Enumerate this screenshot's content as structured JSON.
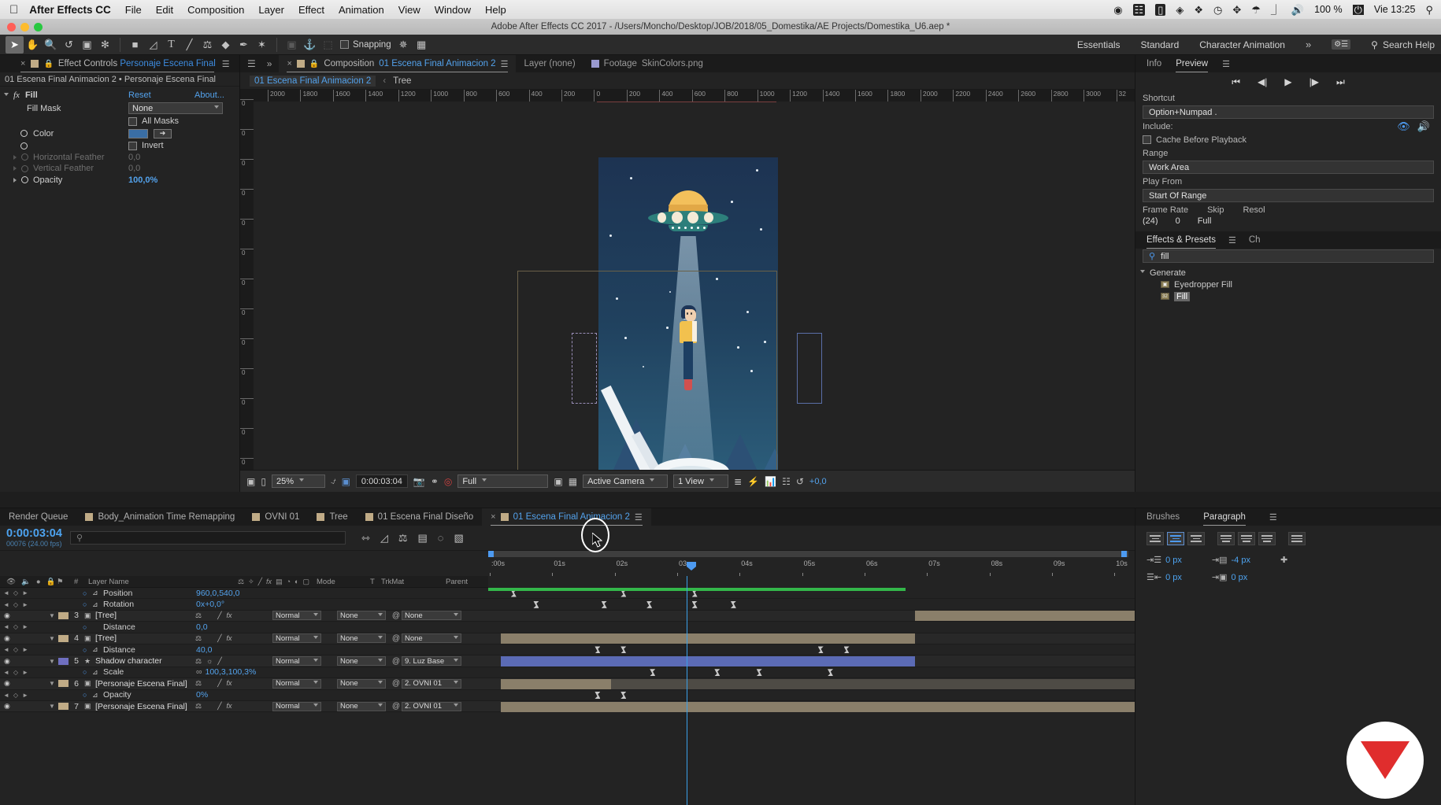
{
  "macbar": {
    "apple_icon": "apple-icon",
    "app_name": "After Effects CC",
    "menus": [
      "File",
      "Edit",
      "Composition",
      "Layer",
      "Effect",
      "Animation",
      "View",
      "Window",
      "Help"
    ],
    "status_icons": [
      "record-icon",
      "screen-share-icon",
      "display-icon",
      "dropbox-icon",
      "evernote-icon",
      "clock-icon",
      "bluetooth-icon",
      "wifi-icon",
      "airplay-icon",
      "volume-icon"
    ],
    "battery_percent": "100 %",
    "battery_icon": "battery-icon",
    "time": "Vie 13:25",
    "spotlight_icon": "search-icon"
  },
  "titlebar": {
    "title": "Adobe After Effects CC 2017 - /Users/Moncho/Desktop/JOB/2018/05_Domestika/AE Projects/Domestika_U6.aep *",
    "close_color": "#ff5f57",
    "min_color": "#febc2e",
    "max_color": "#28c840"
  },
  "toolbar": {
    "tools": [
      {
        "name": "selection-tool-icon",
        "glyph": "➤",
        "active": true
      },
      {
        "name": "hand-tool-icon",
        "glyph": "✋",
        "active": false
      },
      {
        "name": "zoom-tool-icon",
        "glyph": "🔍",
        "active": false
      },
      {
        "name": "rotation-tool-icon",
        "glyph": "↺",
        "active": false
      },
      {
        "name": "camera-tool-icon",
        "glyph": "🎥",
        "active": false
      },
      {
        "name": "pan-behind-tool-icon",
        "glyph": "✥",
        "active": false
      },
      {
        "name": "rectangle-tool-icon",
        "glyph": "■",
        "active": false
      },
      {
        "name": "pen-tool-icon",
        "glyph": "◹",
        "active": false
      },
      {
        "name": "type-tool-icon",
        "glyph": "T",
        "active": false
      },
      {
        "name": "brush-tool-icon",
        "glyph": "╱",
        "active": false
      },
      {
        "name": "clone-stamp-tool-icon",
        "glyph": "⚒",
        "active": false
      },
      {
        "name": "eraser-tool-icon",
        "glyph": "◆",
        "active": false
      },
      {
        "name": "roto-brush-tool-icon",
        "glyph": "✒",
        "active": false
      },
      {
        "name": "puppet-pin-tool-icon",
        "glyph": "✦",
        "active": false
      }
    ],
    "dim_tools": [
      {
        "name": "align-tool-icon",
        "glyph": "▣"
      },
      {
        "name": "anchor-tool-icon",
        "glyph": "⚓"
      },
      {
        "name": "mask-tool-icon",
        "glyph": "⬚"
      }
    ],
    "snapping_label": "Snapping",
    "snapping_checked": false,
    "snap_extra_icons": [
      "magnet-icon",
      "grid-icon"
    ],
    "workspaces": [
      "Essentials",
      "Standard",
      "Character Animation"
    ],
    "workspace_overflow": "»",
    "workspace_settings_icon": "workspace-settings-icon",
    "search_placeholder": "Search Help",
    "search_icon": "search-icon"
  },
  "effect_controls": {
    "tab_prefix": "Effect Controls",
    "tab_name": "Personaje Escena Final",
    "close_icon": "close-icon",
    "lock_icon": "lock-icon",
    "menu_icon": "panel-menu-icon",
    "swatch_color": "#c0ab86",
    "breadcrumb": "01 Escena Final Animacion 2 • Personaje Escena Final",
    "effect_title": "Fill",
    "fx_icon": "fx-icon",
    "reset_label": "Reset",
    "about_label": "About...",
    "properties": [
      {
        "label": "Fill Mask",
        "value": "None",
        "type": "dropdown",
        "dim": false
      },
      {
        "label": "All Masks",
        "value": "",
        "type": "checkbox",
        "checked": false,
        "dim": false
      },
      {
        "label": "Color",
        "value": "",
        "type": "color",
        "color": "#3a6ea5",
        "dim": false
      },
      {
        "label": "Invert",
        "value": "",
        "type": "checkbox",
        "checked": false,
        "dim": false
      },
      {
        "label": "Horizontal Feather",
        "value": "0,0",
        "type": "number",
        "dim": true
      },
      {
        "label": "Vertical Feather",
        "value": "0,0",
        "type": "number",
        "dim": true
      },
      {
        "label": "Opacity",
        "value": "100,0%",
        "type": "number",
        "dim": false
      }
    ]
  },
  "composition": {
    "tabs": [
      {
        "label_prefix": "Composition",
        "label": "01 Escena Final Animacion 2",
        "selected": true,
        "swatch": "#c0ab86",
        "close_icon": "close-icon",
        "lock_icon": "lock-icon",
        "menu_icon": "panel-menu-icon"
      },
      {
        "label_prefix": "",
        "label": "Layer (none)",
        "selected": false,
        "swatch": ""
      },
      {
        "label_prefix": "Footage",
        "label": "SkinColors.png",
        "selected": false,
        "swatch": "#9a9ad0"
      }
    ],
    "breadcrumb_active": "01 Escena Final Animacion 2",
    "breadcrumb_sep": "‹",
    "breadcrumb_next": "Tree",
    "ruler_h_labels": [
      "2000",
      "1800",
      "1600",
      "1400",
      "1200",
      "1000",
      "800",
      "600",
      "400",
      "200",
      "0",
      "200",
      "400",
      "600",
      "800",
      "1000",
      "1200",
      "1400",
      "1600",
      "1800",
      "2000",
      "2200",
      "2400",
      "2600",
      "2800",
      "3000",
      "32"
    ],
    "ruler_v_labels": [
      "0",
      "0",
      "0",
      "0",
      "0",
      "0",
      "0",
      "0",
      "0",
      "0",
      "0",
      "0"
    ],
    "bottom_bar": {
      "zoom": "25%",
      "time": "0:00:03:04",
      "resolution": "Full",
      "camera": "Active Camera",
      "views": "1 View",
      "exposure": "+0,0",
      "icons": [
        "toggle-transparency-grid-icon",
        "toggle-mask-icon",
        "region-of-interest-icon",
        "take-snapshot-icon",
        "show-snapshot-icon",
        "show-channel-icon",
        "toggle-alpha-icon",
        "toggle-guides-icon",
        "toggle-3d-view-icon",
        "timeline-graph-icon",
        "renderer-icon",
        "reset-exposure-icon"
      ]
    },
    "artwork": {
      "sky_top": "#1e3a55",
      "sky_bottom": "#2a5d7a",
      "ufo_dome": "#f3c05b",
      "ufo_body": "#2d7f7b",
      "beam": "#9fc3d6",
      "shirt": "#f2c14e",
      "pants": "#1d3f63",
      "shoe": "#d1504f",
      "hair": "#1d3557",
      "skin": "#f0d0b0",
      "mountain": "#39648c"
    }
  },
  "right_panels": {
    "top_tabs": [
      {
        "label": "Info",
        "selected": false
      },
      {
        "label": "Preview",
        "selected": true
      }
    ],
    "menu_icon": "panel-menu-icon",
    "transport": [
      "skip-to-start-icon",
      "step-back-icon",
      "play-icon",
      "step-forward-icon",
      "skip-to-end-icon"
    ],
    "shortcut_label": "Shortcut",
    "shortcut_value": "Option+Numpad .",
    "include_label": "Include:",
    "include_icons": [
      "video-include-icon",
      "audio-include-icon"
    ],
    "cache_label": "Cache Before Playback",
    "cache_checked": false,
    "range_label": "Range",
    "range_value": "Work Area",
    "play_from_label": "Play From",
    "play_from_value": "Start Of Range",
    "frame_rate_label": "Frame Rate",
    "skip_label": "Skip",
    "resolution_label": "Resol",
    "frame_rate_value": "(24)",
    "skip_value": "0",
    "resolution_value": "Full",
    "effects_tab": "Effects & Presets",
    "effects_extra_tab": "Ch",
    "effects_search_value": "fill",
    "effects_search_icon": "search-icon",
    "effects_tree": [
      {
        "label": "Generate",
        "type": "group",
        "expanded": true
      },
      {
        "label": "Eyedropper Fill",
        "type": "item",
        "selected": false
      },
      {
        "label": "Fill",
        "type": "item",
        "selected": true
      }
    ]
  },
  "timeline": {
    "tabs": [
      {
        "label": "Render Queue",
        "swatch": "",
        "selected": false
      },
      {
        "label": "Body_Animation Time Remapping",
        "swatch": "#c0ab86",
        "selected": false
      },
      {
        "label": "OVNI 01",
        "swatch": "#c0ab86",
        "selected": false
      },
      {
        "label": "Tree",
        "swatch": "#c0ab86",
        "selected": false
      },
      {
        "label": "01 Escena Final Diseño",
        "swatch": "#c0ab86",
        "selected": false
      },
      {
        "label": "01 Escena Final Animacion 2",
        "swatch": "#c0ab86",
        "selected": true,
        "close_icon": "close-icon",
        "menu_icon": "panel-menu-icon"
      }
    ],
    "current_time": "0:00:03:04",
    "current_frame": "00076 (24.00 fps)",
    "search_placeholder": "",
    "search_icon": "search-icon",
    "head_icons": [
      "composition-mini-flowchart-icon",
      "draft-3d-icon",
      "hide-shy-layers-icon",
      "frame-blending-icon",
      "motion-blur-icon",
      "graph-editor-icon"
    ],
    "columns": [
      "Layer Name",
      "Mode",
      "T",
      "TrkMat",
      "Parent"
    ],
    "column_icons": [
      "video-icon",
      "audio-icon",
      "solo-icon",
      "lock-icon",
      "label-icon",
      "index-icon"
    ],
    "switch_icons": [
      "shy-icon",
      "collapse-icon",
      "quality-icon",
      "fx-icon",
      "frame-blend-icon",
      "motion-blur-icon",
      "adjustment-icon",
      "3d-icon"
    ],
    "ruler_labels": [
      "​:00s",
      "01s",
      "02s",
      "03s",
      "04s",
      "05s",
      "06s",
      "07s",
      "08s",
      "09s",
      "10s"
    ],
    "rows": [
      {
        "kind": "prop",
        "name": "Position",
        "value": "960,0,540,0",
        "has_stopwatch": true,
        "has_graph": true,
        "keys": [
          3.5,
          20.5,
          31.5
        ]
      },
      {
        "kind": "prop",
        "name": "Rotation",
        "value": "0x+0,0°",
        "has_stopwatch": true,
        "has_graph": true,
        "keys": [
          7.0,
          17.5,
          24.5,
          31.5,
          37.5
        ]
      },
      {
        "kind": "layer",
        "index": "3",
        "name": "[Tree]",
        "label_color": "#c0ab86",
        "mode": "Normal",
        "trkmat": "None",
        "parent": "None",
        "bar": {
          "start": 66,
          "end": 103,
          "color": "#8a7f6a"
        }
      },
      {
        "kind": "prop",
        "name": "Distance",
        "value": "0,0",
        "has_stopwatch": true,
        "has_graph": false,
        "keys": []
      },
      {
        "kind": "layer",
        "index": "4",
        "name": "[Tree]",
        "label_color": "#c0ab86",
        "mode": "Normal",
        "trkmat": "None",
        "parent": "None",
        "bar": {
          "start": 2,
          "end": 66,
          "color": "#8a7f6a"
        }
      },
      {
        "kind": "prop",
        "name": "Distance",
        "value": "40,0",
        "has_stopwatch": true,
        "has_graph": true,
        "keys": [
          16.5,
          20.5,
          51,
          55
        ]
      },
      {
        "kind": "layer",
        "index": "5",
        "name": "Shadow character",
        "label_color": "#6f6fc0",
        "mode": "Normal",
        "trkmat": "None",
        "parent": "9. Luz Base",
        "star": true,
        "bar": {
          "start": 2,
          "end": 66,
          "color": "#5b6bb5"
        }
      },
      {
        "kind": "prop",
        "name": "Scale",
        "value": "100,3,100,3%",
        "has_stopwatch": true,
        "has_graph": true,
        "link": true,
        "keys": [
          25,
          35,
          41.5,
          52.5
        ]
      },
      {
        "kind": "layer",
        "index": "6",
        "name": "[Personaje Escena Final]",
        "label_color": "#c0ab86",
        "mode": "Normal",
        "trkmat": "None",
        "parent": "2. OVNI 01",
        "bar": {
          "start": 2,
          "end": 100,
          "color": "#4e4b45"
        },
        "bar2": {
          "start": 2,
          "end": 19,
          "color": "#8a7f6a"
        }
      },
      {
        "kind": "prop",
        "name": "Opacity",
        "value": "0%",
        "has_stopwatch": true,
        "has_graph": true,
        "keys": [
          16.5,
          20.5
        ]
      },
      {
        "kind": "layer",
        "index": "7",
        "name": "[Personaje Escena Final]",
        "label_color": "#c0ab86",
        "mode": "Normal",
        "trkmat": "None",
        "parent": "2. OVNI 01",
        "bar": {
          "start": 2,
          "end": 100,
          "color": "#8a7f6a"
        }
      }
    ]
  },
  "bottom_right": {
    "tabs": [
      {
        "label": "Brushes",
        "selected": false
      },
      {
        "label": "Paragraph",
        "selected": true
      }
    ],
    "menu_icon": "panel-menu-icon",
    "align_buttons": [
      "align-left-icon",
      "align-center-icon",
      "align-right-icon",
      "justify-last-left-icon",
      "justify-last-center-icon",
      "justify-last-right-icon"
    ],
    "selected_align_index": 1,
    "indent_left_label": "0 px",
    "indent_right_label": "0 px",
    "space_before_label": "-4 px",
    "space_after_label": "0 px",
    "indent_left_icon": "indent-left-icon",
    "indent_right_icon": "indent-right-icon",
    "space_before_icon": "space-before-icon",
    "space_after_icon": "space-after-icon"
  }
}
